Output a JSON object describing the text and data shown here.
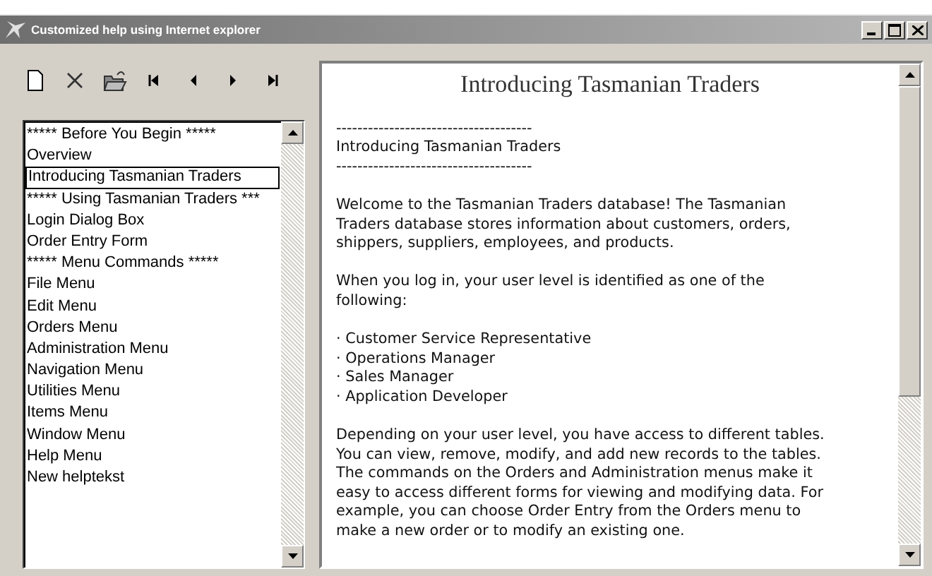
{
  "window": {
    "title": "Customized help using Internet explorer"
  },
  "toolbar": [
    {
      "kind": "new"
    },
    {
      "kind": "delete"
    },
    {
      "kind": "open"
    },
    {
      "kind": "first"
    },
    {
      "kind": "prev"
    },
    {
      "kind": "next"
    },
    {
      "kind": "last"
    }
  ],
  "topics": [
    {
      "label": "***** Before You Begin *****",
      "selected": false
    },
    {
      "label": "Overview",
      "selected": false
    },
    {
      "label": "Introducing Tasmanian Traders",
      "selected": true
    },
    {
      "label": "***** Using Tasmanian Traders ***",
      "selected": false
    },
    {
      "label": "Login Dialog Box",
      "selected": false
    },
    {
      "label": "Order Entry Form",
      "selected": false
    },
    {
      "label": "***** Menu Commands *****",
      "selected": false
    },
    {
      "label": "File Menu",
      "selected": false
    },
    {
      "label": "Edit Menu",
      "selected": false
    },
    {
      "label": "Orders Menu",
      "selected": false
    },
    {
      "label": "Administration Menu",
      "selected": false
    },
    {
      "label": "Navigation Menu",
      "selected": false
    },
    {
      "label": "Utilities Menu",
      "selected": false
    },
    {
      "label": "Items Menu",
      "selected": false
    },
    {
      "label": "Window Menu",
      "selected": false
    },
    {
      "label": "Help Menu",
      "selected": false
    },
    {
      "label": "New helptekst",
      "selected": false
    }
  ],
  "content": {
    "heading": "Introducing Tasmanian Traders",
    "blocks": [
      {
        "kind": "text",
        "text": "-------------------------------------\nIntroducing Tasmanian Traders\n-------------------------------------"
      },
      {
        "kind": "text",
        "text": "Welcome to the Tasmanian Traders database! The Tasmanian\nTraders database stores information about customers, orders,\nshippers, suppliers, employees, and products."
      },
      {
        "kind": "text",
        "text": "When you log in, your user level is identified as one of the\nfollowing:"
      },
      {
        "kind": "list",
        "items": [
          "· Customer Service Representative",
          "· Operations Manager",
          "· Sales Manager",
          "· Application Developer"
        ]
      },
      {
        "kind": "text",
        "text": "Depending on your user level, you have access to different tables.\nYou can view, remove, modify, and add new records to the tables.\nThe commands on the Orders and Administration menus make it\neasy to access different forms for viewing and modifying data. For\nexample, you can choose Order Entry from the Orders menu to\nmake a new order or to modify an existing one."
      }
    ]
  }
}
